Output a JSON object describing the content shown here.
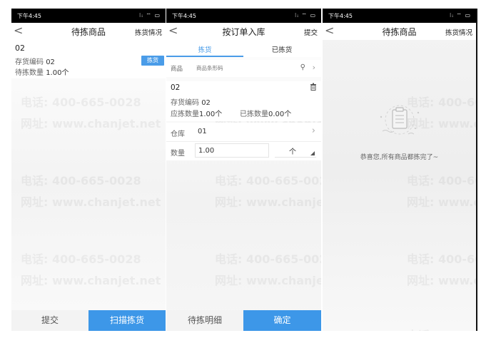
{
  "watermark": {
    "phone": "电话: 400-665-0028",
    "site": "网址: www.chanjet.net"
  },
  "status_bar": {
    "time": "下午4:45",
    "icons": "⁝ᵢ ⌔ ▭"
  },
  "screen1": {
    "title": "待拣商品",
    "right_link": "拣货情况",
    "back": "<",
    "item": {
      "name": "02",
      "code_label": "存货编码",
      "code": "02",
      "qty_label": "待拣数量",
      "qty": "1.00个",
      "pick_button": "拣货"
    },
    "submit": "提交",
    "scan_button": "扫描拣货"
  },
  "screen2": {
    "title": "按订单入库",
    "right_link": "提交",
    "back": "<",
    "tabs": [
      {
        "label": "拣货",
        "active": true
      },
      {
        "label": "已拣货",
        "active": false
      }
    ],
    "search": {
      "label": "商品",
      "placeholder": "商品条形码"
    },
    "item": {
      "name": "02",
      "code_label": "存货编码",
      "code": "02",
      "due_label": "应拣数量",
      "due": "1.00个",
      "picked_label": "已拣数量",
      "picked": "0.00个"
    },
    "warehouse": {
      "label": "仓库",
      "value": "01"
    },
    "quantity": {
      "label": "数量",
      "value": "1.00",
      "unit": "个"
    },
    "detail": "待拣明细",
    "confirm": "确定"
  },
  "screen3": {
    "title": "待拣商品",
    "right_link": "拣货情况",
    "back": "<",
    "empty_text": "恭喜您,所有商品都拣完了~"
  },
  "colors": {
    "accent": "#4a9ce8",
    "button": "#3d97e8"
  }
}
